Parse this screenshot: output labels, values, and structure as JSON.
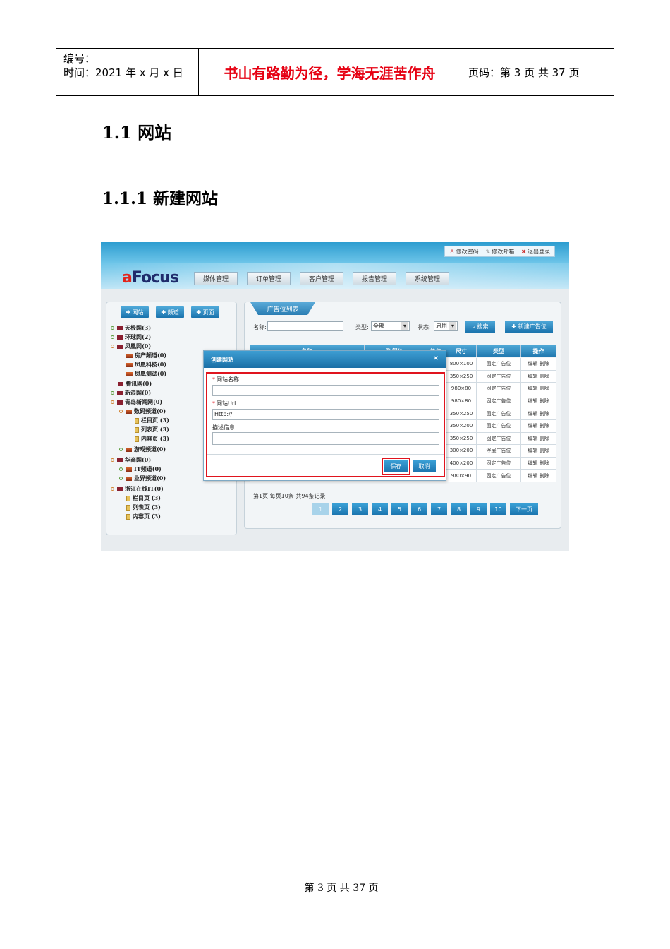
{
  "header": {
    "number_label": "编号：",
    "time_label": "时间：2021 年 x 月 x 日",
    "motto": "书山有路勤为径，学海无涯苦作舟",
    "page_label": "页码：第 3 页  共 37 页"
  },
  "headings": {
    "h1": "1.1 网站",
    "h2": "1.1.1 新建网站"
  },
  "app": {
    "top_links": [
      "修改密码",
      "修改邮箱",
      "退出登录"
    ],
    "logo_a": "a",
    "logo_rest": "Focus",
    "nav_tabs": [
      "媒体管理",
      "订单管理",
      "客户管理",
      "报告管理",
      "系统管理"
    ],
    "left_buttons": [
      "网站",
      "频道",
      "页面"
    ],
    "tree": [
      {
        "label": "天极网(3)",
        "icon": "site-icon",
        "dot": "g"
      },
      {
        "label": "环球网(2)",
        "icon": "site-icon",
        "dot": "g"
      },
      {
        "label": "凤凰网(0)",
        "icon": "site-icon",
        "dot": "o"
      },
      {
        "label": "房产频道(0)",
        "icon": "channel-icon",
        "dot": ""
      },
      {
        "label": "凤凰科技(0)",
        "icon": "channel-icon",
        "dot": ""
      },
      {
        "label": "凤凰测试(0)",
        "icon": "channel-icon",
        "dot": ""
      },
      {
        "label": "腾讯网(0)",
        "icon": "site-icon",
        "dot": ""
      },
      {
        "label": "新浪网(0)",
        "icon": "site-icon",
        "dot": "g"
      },
      {
        "label": "青岛新闻网(0)",
        "icon": "site-icon",
        "dot": "o"
      },
      {
        "label": "数码频道(0)",
        "icon": "channel-icon",
        "dot": "o"
      },
      {
        "label": "栏目页 (3)",
        "icon": "page-icon",
        "dot": ""
      },
      {
        "label": "列表页 (3)",
        "icon": "page-icon",
        "dot": ""
      },
      {
        "label": "内容页 (3)",
        "icon": "page-icon",
        "dot": ""
      },
      {
        "label": "游戏频道(0)",
        "icon": "channel-icon",
        "dot": "g"
      },
      {
        "label": "华商网(0)",
        "icon": "site-icon",
        "dot": "o"
      },
      {
        "label": "IT频道(0)",
        "icon": "channel-icon",
        "dot": "g"
      },
      {
        "label": "业界频道(0)",
        "icon": "channel-icon",
        "dot": "g"
      },
      {
        "label": "浙江在线IT(0)",
        "icon": "site-icon",
        "dot": "o"
      },
      {
        "label": "栏目页 (3)",
        "icon": "page-icon",
        "dot": ""
      },
      {
        "label": "列表页 (3)",
        "icon": "page-icon",
        "dot": ""
      },
      {
        "label": "内容页 (3)",
        "icon": "page-icon",
        "dot": ""
      }
    ],
    "list_tab": "广告位列表",
    "filter": {
      "name_label": "名称:",
      "type_label": "类型:",
      "type_value": "全部",
      "status_label": "状态:",
      "status_value": "启用",
      "search_button": "搜索",
      "new_button": "新建广告位"
    },
    "table": {
      "headers": [
        "名称",
        "刊例价",
        "单位",
        "尺寸",
        "类型",
        "操作"
      ],
      "rows": [
        {
          "size": "800×100",
          "type": "固定广告位",
          "ops": "编辑 删除"
        },
        {
          "size": "350×250",
          "type": "固定广告位",
          "ops": "编辑 删除"
        },
        {
          "size": "980×80",
          "type": "固定广告位",
          "ops": "编辑 删除"
        },
        {
          "size": "980×80",
          "type": "固定广告位",
          "ops": "编辑 删除"
        },
        {
          "size": "350×250",
          "type": "固定广告位",
          "ops": "编辑 删除"
        },
        {
          "size": "350×200",
          "type": "固定广告位",
          "ops": "编辑 删除"
        },
        {
          "size": "350×250",
          "type": "固定广告位",
          "ops": "编辑 删除"
        },
        {
          "size": "300×200",
          "type": "浮层广告位",
          "ops": "编辑 删除"
        },
        {
          "size": "400×200",
          "type": "固定广告位",
          "ops": "编辑 删除"
        },
        {
          "size": "980×90",
          "type": "固定广告位",
          "ops": "编辑 删除"
        }
      ]
    },
    "pager_info": "第1页  每页10条  共94条记录",
    "pages": [
      "1",
      "2",
      "3",
      "4",
      "5",
      "6",
      "7",
      "8",
      "9",
      "10"
    ],
    "next_page": "下一页",
    "dialog": {
      "title": "创建网站",
      "close": "×",
      "site_name_label": "网站名称",
      "site_url_label": "网站Url",
      "site_url_value": "Http://",
      "desc_label": "描述信息",
      "save": "保存",
      "cancel": "取消"
    }
  },
  "footer": "第 3 页 共 37 页"
}
